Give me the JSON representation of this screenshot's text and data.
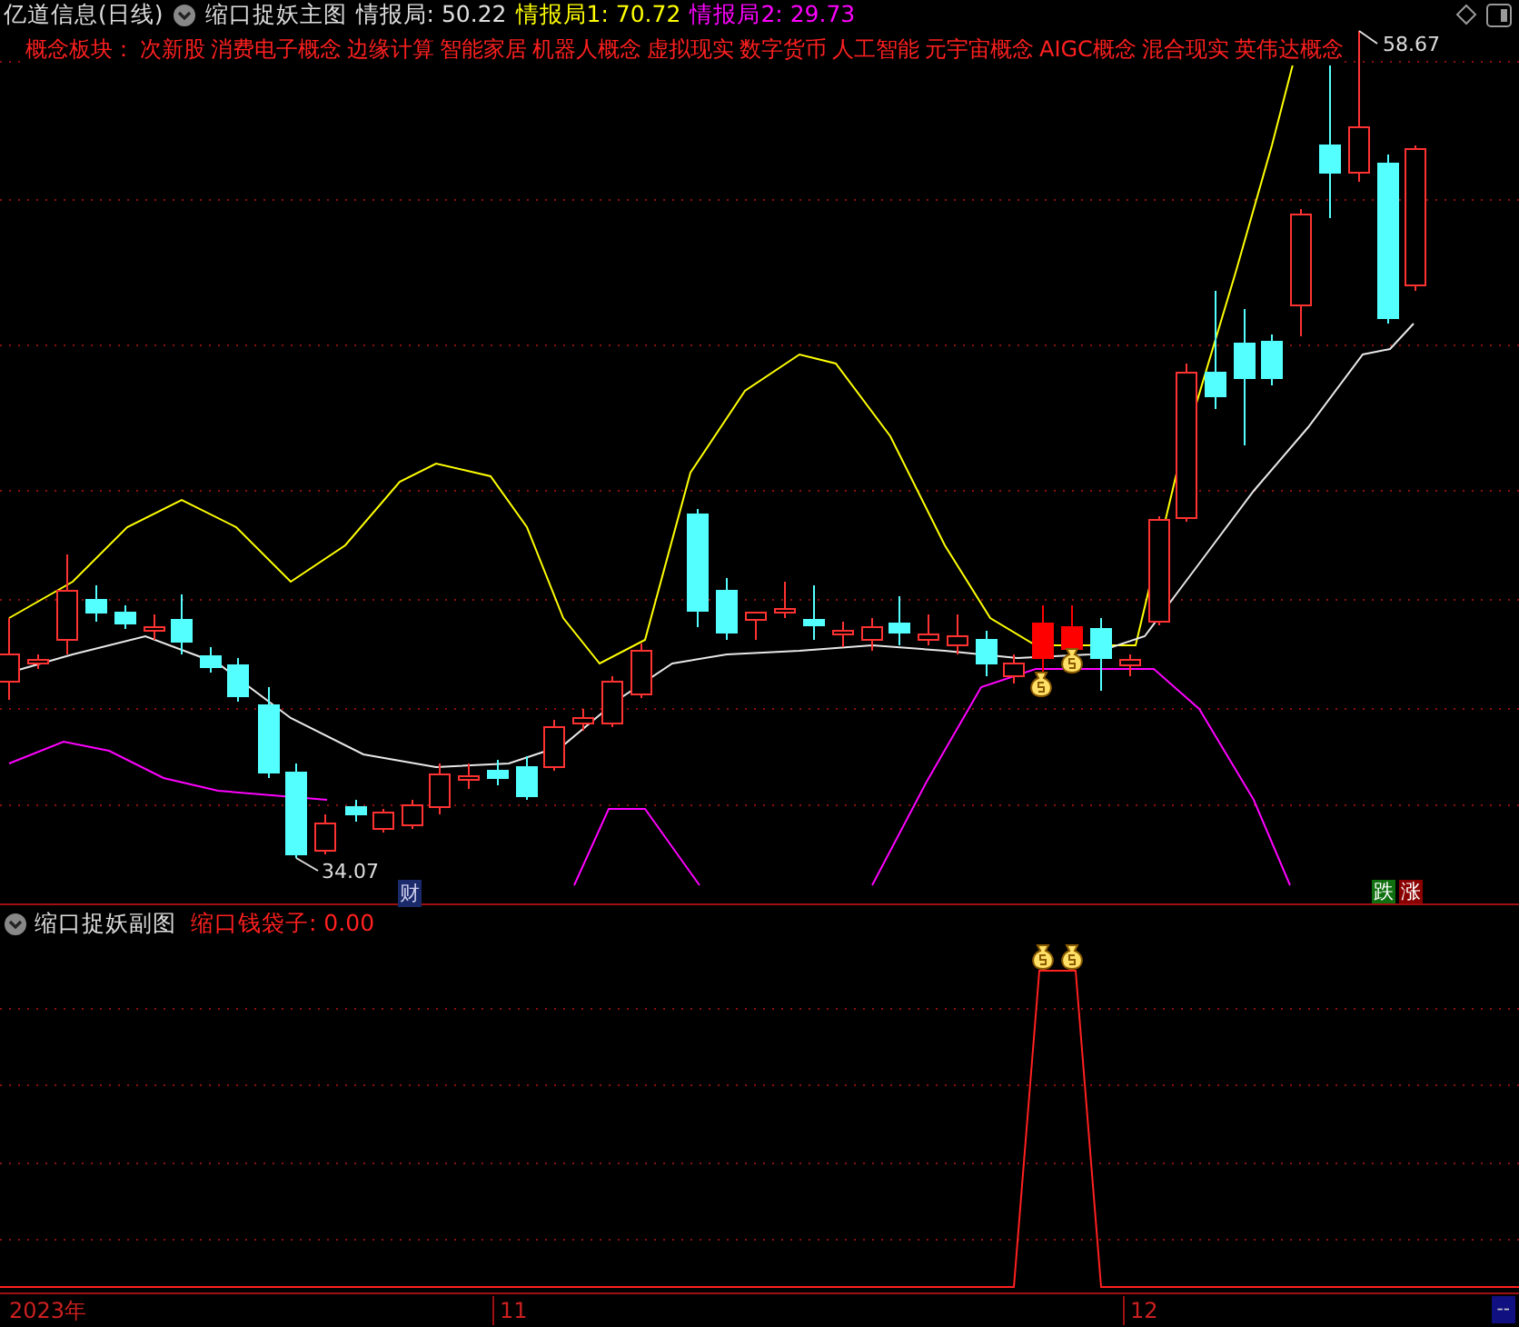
{
  "title_bar": {
    "stock": "亿道信息(日线)",
    "main_indicator": "缩口捉妖主图",
    "readouts": [
      {
        "label": "情报局: 50.22",
        "color": "#e0e0e0"
      },
      {
        "label": "情报局1: 70.72",
        "color": "#ffff00"
      },
      {
        "label": "情报局2: 29.73",
        "color": "#ff00ff"
      }
    ]
  },
  "concepts": {
    "label": "概念板块：",
    "items": [
      "次新股",
      "消费电子概念",
      "边缘计算",
      "智能家居",
      "机器人概念",
      "虚拟现实",
      "数字货币",
      "人工智能",
      "元宇宙概念",
      "AIGC概念",
      "混合现实",
      "英伟达概念"
    ]
  },
  "main_chart": {
    "high_label": "58.67",
    "low_label": "34.07",
    "finance_marker": "财",
    "badges": [
      {
        "text": "跌",
        "kind": "down"
      },
      {
        "text": "涨",
        "kind": "up"
      }
    ]
  },
  "sub_chart": {
    "title": "缩口捉妖副图",
    "readout": "缩口钱袋子: 0.00"
  },
  "time_axis": {
    "labels": [
      "2023年",
      "11",
      "12"
    ],
    "corner": "--"
  }
}
